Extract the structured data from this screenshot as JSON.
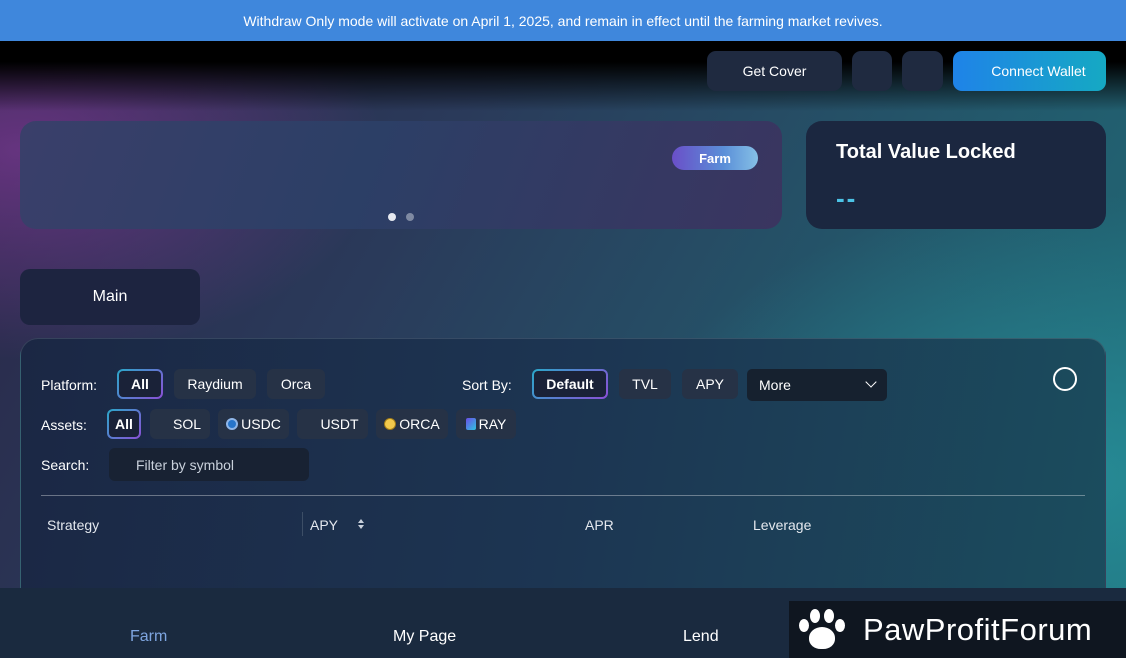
{
  "banner": {
    "text": "Withdraw Only mode will activate on April 1, 2025, and remain in effect until the farming market revives."
  },
  "header": {
    "get_cover_label": "Get Cover",
    "connect_wallet_label": "Connect Wallet"
  },
  "hero": {
    "badge_label": "Farm",
    "active_slide": 1,
    "slide_count": 2
  },
  "tvl": {
    "title": "Total Value Locked",
    "value": "--"
  },
  "tabs": {
    "main_label": "Main"
  },
  "filters": {
    "platform_label": "Platform:",
    "platforms": [
      "All",
      "Raydium",
      "Orca"
    ],
    "sort_label": "Sort By:",
    "sort_options": [
      "Default",
      "TVL",
      "APY"
    ],
    "more_select": "More",
    "assets_label": "Assets:",
    "assets": [
      "All",
      "SOL",
      "USDC",
      "USDT",
      "ORCA",
      "RAY"
    ],
    "search_label": "Search:",
    "search_placeholder": "Filter by symbol"
  },
  "table": {
    "columns": [
      "Strategy",
      "APY",
      "APR",
      "Leverage"
    ]
  },
  "bottom_nav": {
    "items": [
      "Farm",
      "My Page",
      "Lend"
    ],
    "active": "Farm"
  },
  "watermark": {
    "text": "PawProfitForum"
  },
  "colors": {
    "banner": "#3f87dc",
    "accent": "#4cc3e6",
    "connect_start": "#1f83e8",
    "connect_end": "#15a9c3"
  }
}
